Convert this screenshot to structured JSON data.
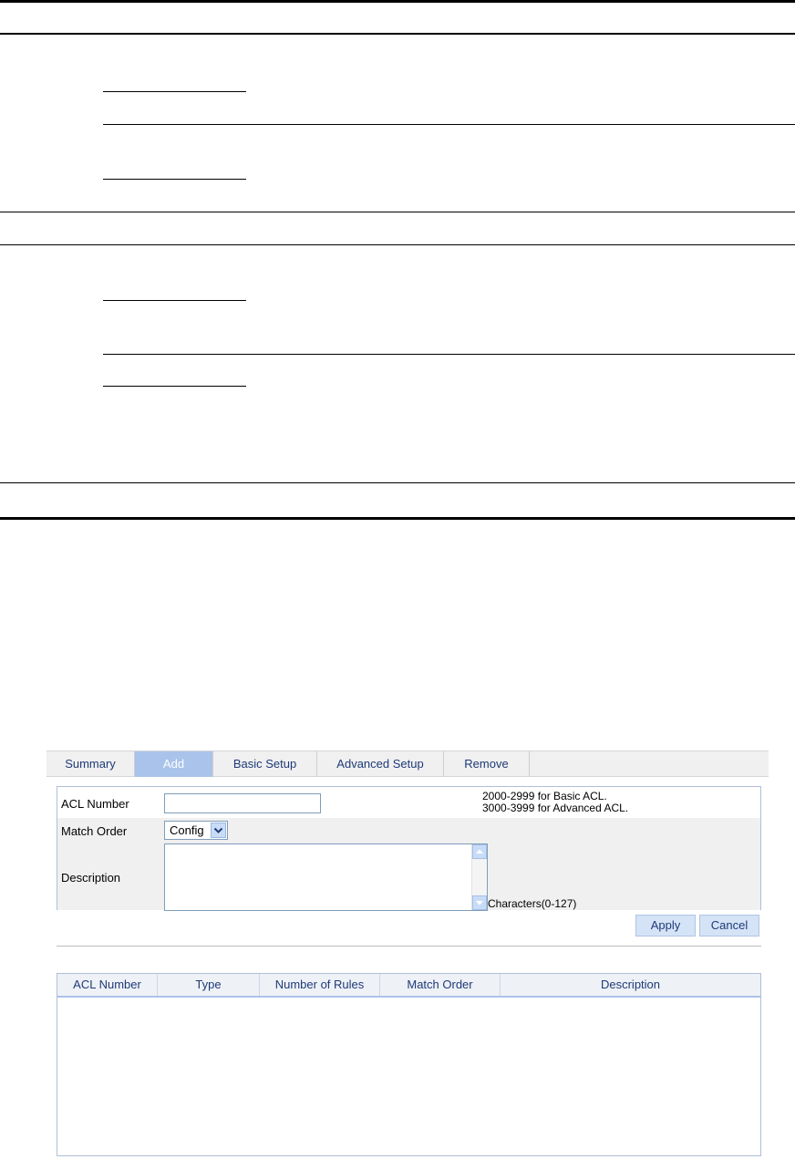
{
  "tabs": [
    {
      "label": "Summary"
    },
    {
      "label": "Add"
    },
    {
      "label": "Basic Setup"
    },
    {
      "label": "Advanced Setup"
    },
    {
      "label": "Remove"
    }
  ],
  "active_tab": "Add",
  "form": {
    "acl_number": {
      "label": "ACL Number",
      "value": ""
    },
    "hint_basic": "2000-2999 for Basic ACL.",
    "hint_advanced": "3000-3999 for Advanced ACL.",
    "match_order": {
      "label": "Match Order",
      "selected": "Config"
    },
    "description": {
      "label": "Description",
      "value": "",
      "hint": "Characters(0-127)"
    }
  },
  "buttons": {
    "apply": "Apply",
    "cancel": "Cancel"
  },
  "table": {
    "columns": [
      "ACL Number",
      "Type",
      "Number of Rules",
      "Match Order",
      "Description"
    ],
    "rows": []
  },
  "colors": {
    "accent": "#a9c3ea",
    "link_text": "#1e3a78",
    "panel_border": "#aebfd8"
  }
}
